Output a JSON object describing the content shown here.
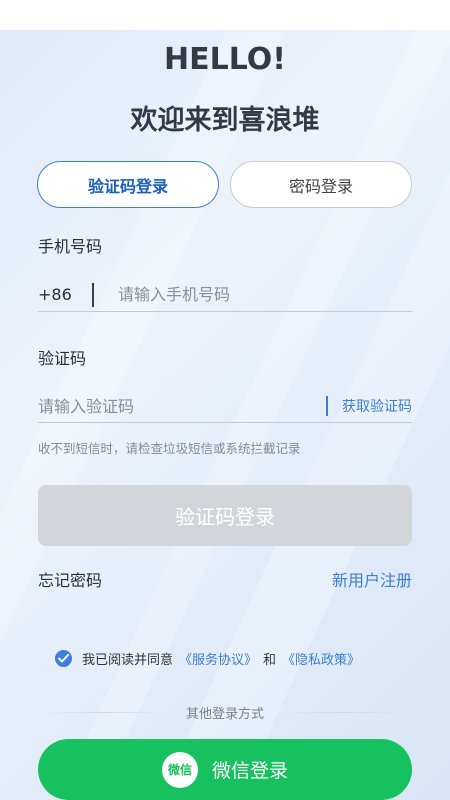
{
  "header": {
    "hello": "HELLO!",
    "welcome": "欢迎来到喜浪堆"
  },
  "tabs": [
    {
      "label": "验证码登录",
      "active": true
    },
    {
      "label": "密码登录",
      "active": false
    }
  ],
  "phone": {
    "label": "手机号码",
    "prefix": "+86",
    "placeholder": "请输入手机号码",
    "value": ""
  },
  "code": {
    "label": "验证码",
    "placeholder": "请输入验证码",
    "value": "",
    "get_code": "获取验证码"
  },
  "hint": "收不到短信时，请检查垃圾短信或系统拦截记录",
  "login_button": "验证码登录",
  "forgot": "忘记密码",
  "register": "新用户注册",
  "agreement": {
    "checked": true,
    "prefix": "我已阅读并同意",
    "service": "《服务协议》",
    "and": "和",
    "privacy": "《隐私政策》"
  },
  "other_login": "其他登录方式",
  "wechat": {
    "icon_text": "微信",
    "label": "微信登录"
  },
  "colors": {
    "accent": "#3c7fd0",
    "wechat": "#17c15f",
    "disabled_button": "#d2d5da"
  }
}
